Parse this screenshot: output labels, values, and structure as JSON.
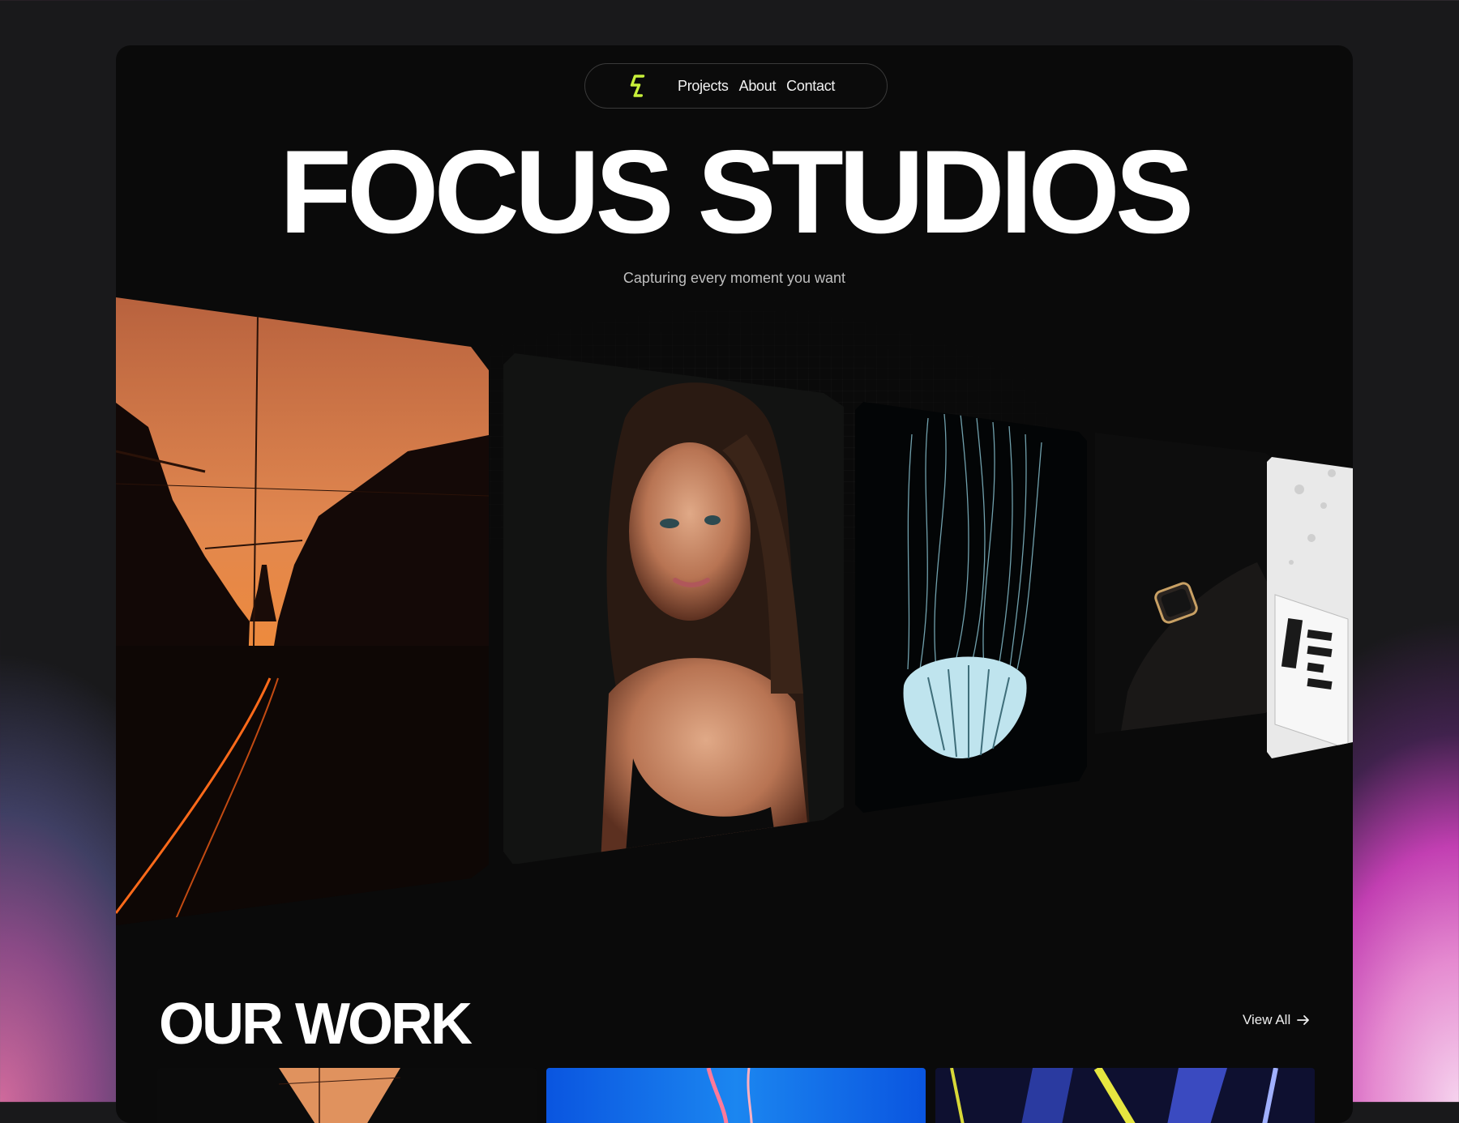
{
  "nav": {
    "logo_icon": "lightning-s-logo",
    "logo_color": "#c7f03a",
    "links": [
      "Projects",
      "About",
      "Contact"
    ]
  },
  "hero": {
    "title": "FOCUS STUDIOS",
    "subtitle": "Capturing every moment you want"
  },
  "gallery": {
    "images": [
      "city-street-sunset",
      "woman-portrait",
      "jellyfish",
      "wrist-watch",
      "boxed-water-carton"
    ]
  },
  "work": {
    "title": "OUR WORK",
    "view_all": "View All",
    "view_all_icon": "arrow-right-icon",
    "thumbnails": [
      "sunset-street-thumb",
      "blue-underwater-thumb",
      "concert-lights-thumb"
    ]
  },
  "colors": {
    "background": "#19191b",
    "frame": "#0a0a0a",
    "accent": "#c7f03a",
    "glow_pink": "#c23fb2"
  }
}
